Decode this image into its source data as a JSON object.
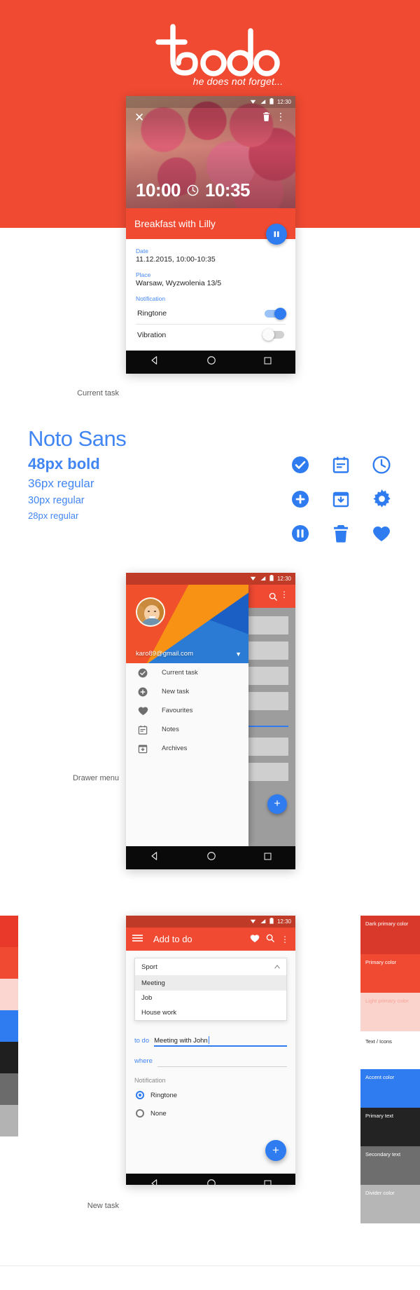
{
  "hero": {
    "logo_text": "todo",
    "tagline": "he does not forget..."
  },
  "phone1": {
    "caption": "Current task",
    "statusbar": {
      "time": "12:30",
      "wifi_icon": "wifi-icon",
      "signal_icon": "signal-icon",
      "battery_icon": "battery-icon"
    },
    "close_icon": "close-icon",
    "delete_icon": "trash-icon",
    "overflow_icon": "more-vertical-icon",
    "start_time": "10:00",
    "clock_icon": "clock-icon",
    "end_time": "10:35",
    "task_title": "Breakfast with Lilly",
    "pause_icon": "pause-icon",
    "details": [
      {
        "label": "Date",
        "value": "11.12.2015, 10:00-10:35"
      },
      {
        "label": "Place",
        "value": "Warsaw, Wyzwolenia 13/5"
      }
    ],
    "notification_label": "Notification",
    "switches": [
      {
        "label": "Ringtone",
        "state": "on"
      },
      {
        "label": "Vibration",
        "state": "off"
      }
    ],
    "nav": {
      "back_icon": "back-triangle-icon",
      "home_icon": "home-circle-icon",
      "recents_icon": "recents-square-icon"
    }
  },
  "typography": {
    "font_name": "Noto Sans",
    "lines": [
      "48px bold",
      "36px regular",
      "30px regular",
      "28px regular"
    ]
  },
  "icons": [
    {
      "name": "check-circle-icon",
      "label": "check circle"
    },
    {
      "name": "calendar-icon",
      "label": "calendar"
    },
    {
      "name": "clock-icon",
      "label": "clock"
    },
    {
      "name": "plus-circle-icon",
      "label": "plus circle"
    },
    {
      "name": "archive-download-icon",
      "label": "archive"
    },
    {
      "name": "gear-icon",
      "label": "settings"
    },
    {
      "name": "pause-circle-icon",
      "label": "pause circle"
    },
    {
      "name": "trash-icon",
      "label": "delete"
    },
    {
      "name": "heart-icon",
      "label": "favourite"
    }
  ],
  "phone2": {
    "caption": "Drawer menu",
    "statusbar": {
      "time": "12:30"
    },
    "email": "karo89@gmail.com",
    "caret_icon": "caret-down-icon",
    "menu": [
      {
        "label": "Current task",
        "icon": "check-circle-icon"
      },
      {
        "label": "New task",
        "icon": "plus-circle-icon"
      },
      {
        "label": "Favourites",
        "icon": "heart-icon"
      },
      {
        "label": "Notes",
        "icon": "calendar-icon"
      },
      {
        "label": "Archives",
        "icon": "archive-download-icon"
      }
    ],
    "fab_icon": "plus-icon",
    "search_icon": "search-icon",
    "overflow_icon": "more-vertical-icon"
  },
  "phone3": {
    "caption": "New task",
    "statusbar": {
      "time": "12:30"
    },
    "menu_icon": "hamburger-icon",
    "title": "Add to do",
    "heart_icon": "heart-icon",
    "search_icon": "search-icon",
    "overflow_icon": "more-vertical-icon",
    "category_selected": "Sport",
    "category_caret_icon": "caret-up-icon",
    "category_options": [
      "Meeting",
      "Job",
      "House work"
    ],
    "category_highlighted": "Meeting",
    "fields": [
      {
        "label": "to do",
        "value": "Meeting with John"
      },
      {
        "label": "where",
        "value": ""
      }
    ],
    "notification_label": "Notification",
    "radios": [
      {
        "label": "Ringtone",
        "selected": true
      },
      {
        "label": "None",
        "selected": false
      }
    ],
    "fab_icon": "plus-icon"
  },
  "palette": {
    "left_strip": [
      "#e8392b",
      "#f04a32",
      "#fbd6d1",
      "#2f7bf0",
      "#1f1f1f",
      "#6b6b6b",
      "#b3b3b3"
    ],
    "right": [
      {
        "label": "Dark primary color",
        "color": "#d8392a",
        "text": "#ffffff"
      },
      {
        "label": "Primary color",
        "color": "#f04a32",
        "text": "#ffffff"
      },
      {
        "label": "Light primary color",
        "color": "#fbd3cd",
        "text": "#f8a79b"
      },
      {
        "label": "Text / Icons",
        "color": "#ffffff",
        "text": "#2b2b2b"
      },
      {
        "label": "Accent color",
        "color": "#2f7bf0",
        "text": "#ffffff"
      },
      {
        "label": "Primary text",
        "color": "#232323",
        "text": "#ffffff"
      },
      {
        "label": "Secondary text",
        "color": "#6e6e6e",
        "text": "#ffffff"
      },
      {
        "label": "Divider color",
        "color": "#b6b6b6",
        "text": "#ffffff"
      }
    ]
  }
}
